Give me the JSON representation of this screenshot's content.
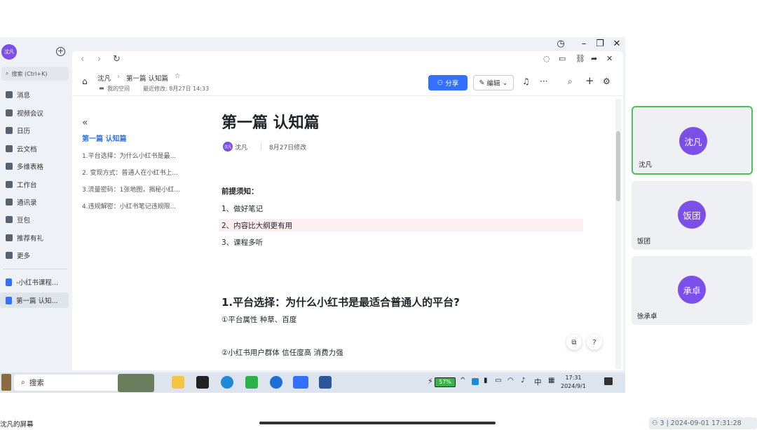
{
  "window": {
    "controls": [
      "◷",
      "–",
      "❐",
      "✕"
    ]
  },
  "sidebar": {
    "user_avatar": "沈凡",
    "search_placeholder": "搜索 (Ctrl+K)",
    "items": [
      {
        "label": "消息",
        "icon": "message-icon"
      },
      {
        "label": "视频会议",
        "icon": "video-icon"
      },
      {
        "label": "日历",
        "icon": "calendar-icon"
      },
      {
        "label": "云文档",
        "icon": "cloud-doc-icon"
      },
      {
        "label": "多维表格",
        "icon": "table-icon"
      },
      {
        "label": "工作台",
        "icon": "workspace-icon"
      },
      {
        "label": "通讯录",
        "icon": "contacts-icon"
      },
      {
        "label": "豆包",
        "icon": "doubao-icon"
      },
      {
        "label": "推荐有礼",
        "icon": "gift-icon"
      },
      {
        "label": "更多",
        "icon": "more-icon"
      }
    ],
    "docs": [
      {
        "label": "-小红书课程...",
        "active": false
      },
      {
        "label": "第一篇 认知...",
        "active": true
      }
    ]
  },
  "doc_header": {
    "breadcrumb_parent": "沈凡",
    "breadcrumb_current": "第一篇 认知篇",
    "space": "我的空间",
    "last_modified": "最近修改: 8月27日 14:33",
    "share_label": "分享",
    "edit_label": "编辑"
  },
  "toc": {
    "title": "第一篇 认知篇",
    "items": [
      "1.平台选择：为什么小红书是最...",
      "2. 变现方式：普通人在小红书上...",
      "3.流量密码：1张地图，揭秘小红...",
      "4.违规解密：小红书笔记违规限..."
    ]
  },
  "article": {
    "title": "第一篇 认知篇",
    "author_avatar": "沈凡",
    "author": "沈凡",
    "modified": "8月27日修改",
    "prereq_heading": "前提须知：",
    "prereq_items": [
      "1、做好笔记",
      "2、内容比大纲更有用",
      "3、课程多听"
    ],
    "section1_heading": "1.平台选择：为什么小红书是最适合普通人的平台?",
    "section1_line1": "①平台属性 种草、百度",
    "section1_line2": "②小红书用户群体    信任度高 消费力强"
  },
  "taskbar": {
    "search_label": "搜索",
    "battery": "57%",
    "ime": "中",
    "time": "17:31",
    "date": "2024/9/1"
  },
  "participants": [
    {
      "avatar": "沈凡",
      "name": "沈凡",
      "active": true
    },
    {
      "avatar": "饭团",
      "name": "饭团",
      "active": false
    },
    {
      "avatar": "承卓",
      "name": "徐承卓",
      "active": false
    }
  ],
  "footer": {
    "screen_owner": "沈凡的屏幕",
    "participant_count": "3",
    "timestamp": "2024-09-01 17:31:28"
  },
  "colors": {
    "accent": "#3370ff",
    "avatar": "#7b4fe8",
    "active_tile": "#4cc159"
  }
}
